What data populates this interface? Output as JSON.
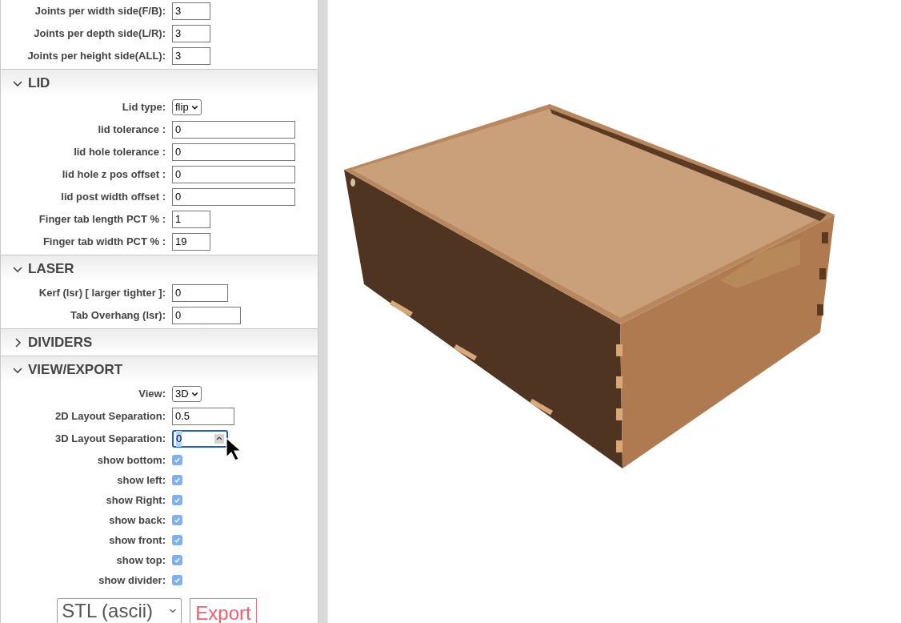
{
  "sections": [
    {
      "fields": [
        {
          "kind": "number",
          "label": "Joints per width side(F/B):",
          "value": "3"
        },
        {
          "kind": "number",
          "label": "Joints per depth side(L/R):",
          "value": "3"
        },
        {
          "kind": "number",
          "label": "Joints per height side(ALL):",
          "value": "3"
        }
      ]
    },
    {
      "title": "LID",
      "expanded": true,
      "fields": [
        {
          "kind": "select",
          "label": "Lid type:",
          "value": "flip"
        },
        {
          "kind": "text",
          "label": "lid tolerance :",
          "value": "0"
        },
        {
          "kind": "text",
          "label": "lid hole tolerance :",
          "value": "0"
        },
        {
          "kind": "text",
          "label": "lid hole z pos offset :",
          "value": "0"
        },
        {
          "kind": "text",
          "label": "lid post width offset :",
          "value": "0"
        },
        {
          "kind": "number",
          "label": "Finger tab length PCT % :",
          "value": "1"
        },
        {
          "kind": "number",
          "label": "Finger tab width PCT % :",
          "value": "19"
        }
      ]
    },
    {
      "title": "LASER",
      "expanded": true,
      "fields": [
        {
          "kind": "number",
          "label": "Kerf (lsr) [ larger tighter ]:",
          "value": "0"
        },
        {
          "kind": "number",
          "label": "Tab Overhang (lsr):",
          "value": "0"
        }
      ]
    },
    {
      "title": "DIVIDERS",
      "expanded": false
    },
    {
      "title": "VIEW/EXPORT",
      "expanded": true,
      "fields": [
        {
          "kind": "select",
          "label": "View:",
          "value": "3D"
        },
        {
          "kind": "number",
          "label": "2D Layout Separation:",
          "value": "0.5"
        },
        {
          "kind": "number",
          "label": "3D Layout Separation:",
          "value": "0",
          "focused": true
        },
        {
          "kind": "checkbox",
          "label": "show bottom:",
          "checked": true
        },
        {
          "kind": "checkbox",
          "label": "show left:",
          "checked": true
        },
        {
          "kind": "checkbox",
          "label": "show Right:",
          "checked": true
        },
        {
          "kind": "checkbox",
          "label": "show back:",
          "checked": true
        },
        {
          "kind": "checkbox",
          "label": "show front:",
          "checked": true
        },
        {
          "kind": "checkbox",
          "label": "show top:",
          "checked": true
        },
        {
          "kind": "checkbox",
          "label": "show divider:",
          "checked": true
        }
      ]
    }
  ],
  "export": {
    "format": "STL (ascii)",
    "button": "Export"
  }
}
